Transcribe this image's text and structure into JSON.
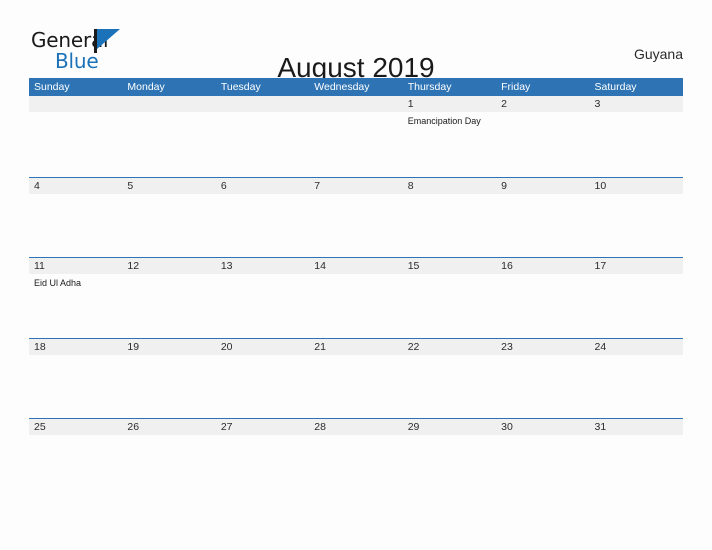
{
  "brand": {
    "name_part1": "General",
    "name_part2": "Blue",
    "flag_icon": "blue-flag-triangle-icon",
    "color_primary": "#1b72b8",
    "color_text": "#1a1a1a"
  },
  "header": {
    "title": "August 2019",
    "country": "Guyana"
  },
  "colors": {
    "header_blue": "#2e74b5",
    "row_divider_blue": "#2e74b5",
    "date_band_gray": "#f0f0f0",
    "cell_white": "#fdfdfd"
  },
  "calendar": {
    "weekdays": [
      "Sunday",
      "Monday",
      "Tuesday",
      "Wednesday",
      "Thursday",
      "Friday",
      "Saturday"
    ],
    "weeks": [
      [
        {
          "date": "",
          "events": []
        },
        {
          "date": "",
          "events": []
        },
        {
          "date": "",
          "events": []
        },
        {
          "date": "",
          "events": []
        },
        {
          "date": "1",
          "events": [
            "Emancipation Day"
          ]
        },
        {
          "date": "2",
          "events": []
        },
        {
          "date": "3",
          "events": []
        }
      ],
      [
        {
          "date": "4",
          "events": []
        },
        {
          "date": "5",
          "events": []
        },
        {
          "date": "6",
          "events": []
        },
        {
          "date": "7",
          "events": []
        },
        {
          "date": "8",
          "events": []
        },
        {
          "date": "9",
          "events": []
        },
        {
          "date": "10",
          "events": []
        }
      ],
      [
        {
          "date": "11",
          "events": [
            "Eid Ul Adha"
          ]
        },
        {
          "date": "12",
          "events": []
        },
        {
          "date": "13",
          "events": []
        },
        {
          "date": "14",
          "events": []
        },
        {
          "date": "15",
          "events": []
        },
        {
          "date": "16",
          "events": []
        },
        {
          "date": "17",
          "events": []
        }
      ],
      [
        {
          "date": "18",
          "events": []
        },
        {
          "date": "19",
          "events": []
        },
        {
          "date": "20",
          "events": []
        },
        {
          "date": "21",
          "events": []
        },
        {
          "date": "22",
          "events": []
        },
        {
          "date": "23",
          "events": []
        },
        {
          "date": "24",
          "events": []
        }
      ],
      [
        {
          "date": "25",
          "events": []
        },
        {
          "date": "26",
          "events": []
        },
        {
          "date": "27",
          "events": []
        },
        {
          "date": "28",
          "events": []
        },
        {
          "date": "29",
          "events": []
        },
        {
          "date": "30",
          "events": []
        },
        {
          "date": "31",
          "events": []
        }
      ]
    ]
  }
}
